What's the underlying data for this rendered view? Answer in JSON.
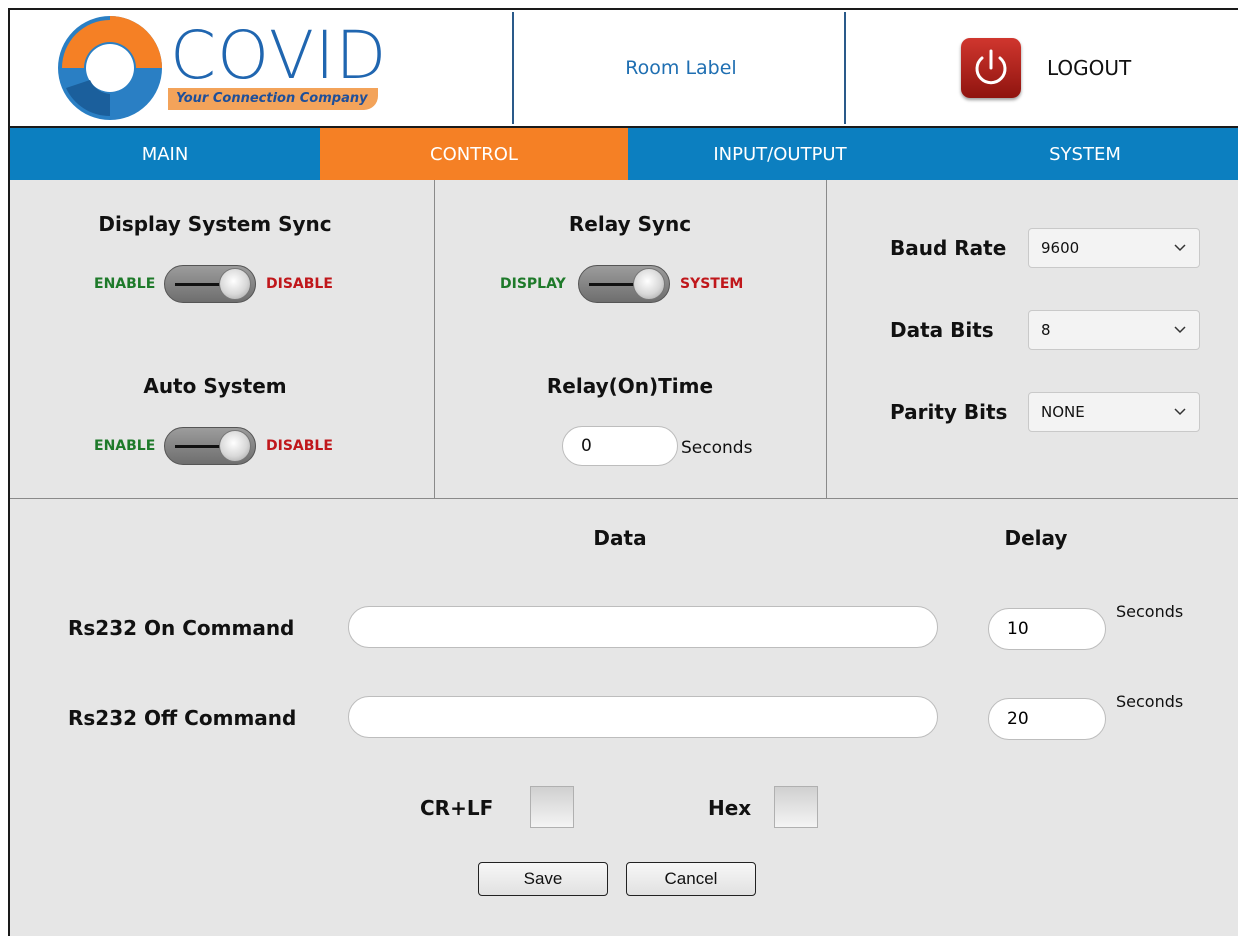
{
  "header": {
    "logo_text": "COVID",
    "logo_tagline": "Your Connection Company",
    "room_label": "Room Label",
    "logout_label": "LOGOUT",
    "power_icon": "power-icon"
  },
  "nav": {
    "tabs": [
      {
        "label": "MAIN",
        "active": false
      },
      {
        "label": "CONTROL",
        "active": true
      },
      {
        "label": "INPUT/OUTPUT",
        "active": false
      },
      {
        "label": "SYSTEM",
        "active": false
      }
    ]
  },
  "display_sync": {
    "title": "Display System Sync",
    "left_label": "ENABLE",
    "right_label": "DISABLE"
  },
  "auto_system": {
    "title": "Auto System",
    "left_label": "ENABLE",
    "right_label": "DISABLE"
  },
  "relay_sync": {
    "title": "Relay Sync",
    "left_label": "DISPLAY",
    "right_label": "SYSTEM"
  },
  "relay_time": {
    "title": "Relay(On)Time",
    "value": "0",
    "unit": "Seconds"
  },
  "serial": {
    "baud_label": "Baud Rate",
    "baud_value": "9600",
    "data_bits_label": "Data Bits",
    "data_bits_value": "8",
    "parity_label": "Parity Bits",
    "parity_value": "NONE"
  },
  "commands": {
    "data_header": "Data",
    "delay_header": "Delay",
    "on_label": "Rs232 On Command",
    "on_value": "",
    "on_delay": "10",
    "off_label": "Rs232 Off Command",
    "off_value": "",
    "off_delay": "20",
    "seconds_label": "Seconds"
  },
  "options": {
    "crlf_label": "CR+LF",
    "hex_label": "Hex"
  },
  "actions": {
    "save_label": "Save",
    "cancel_label": "Cancel"
  },
  "colors": {
    "nav_blue": "#0c7fc0",
    "active_orange": "#f58025",
    "enable_green": "#1e7a2a",
    "disable_red": "#c0171b"
  }
}
